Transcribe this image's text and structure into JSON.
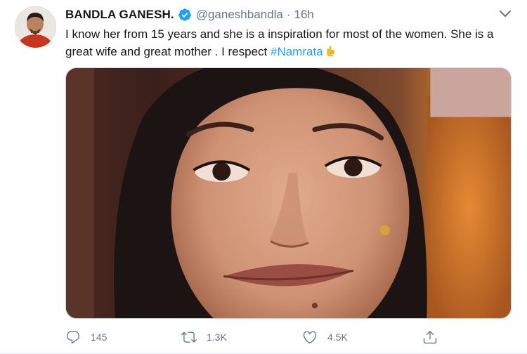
{
  "tweet": {
    "display_name": "BANDLA GANESH.",
    "handle": "@ganeshbandla",
    "separator": "·",
    "time": "16h",
    "text_before": "I know her from 15 years and she is a inspiration for most of the women. She is a great wife and great mother . I respect ",
    "hashtag": "#Namrata",
    "verified": true,
    "emoji": "ok-hand-emoji"
  },
  "actions": {
    "reply_count": "145",
    "retweet_count": "1.3K",
    "like_count": "4.5K"
  },
  "colors": {
    "link": "#1da1f2",
    "muted": "#657786",
    "text": "#14171a"
  }
}
